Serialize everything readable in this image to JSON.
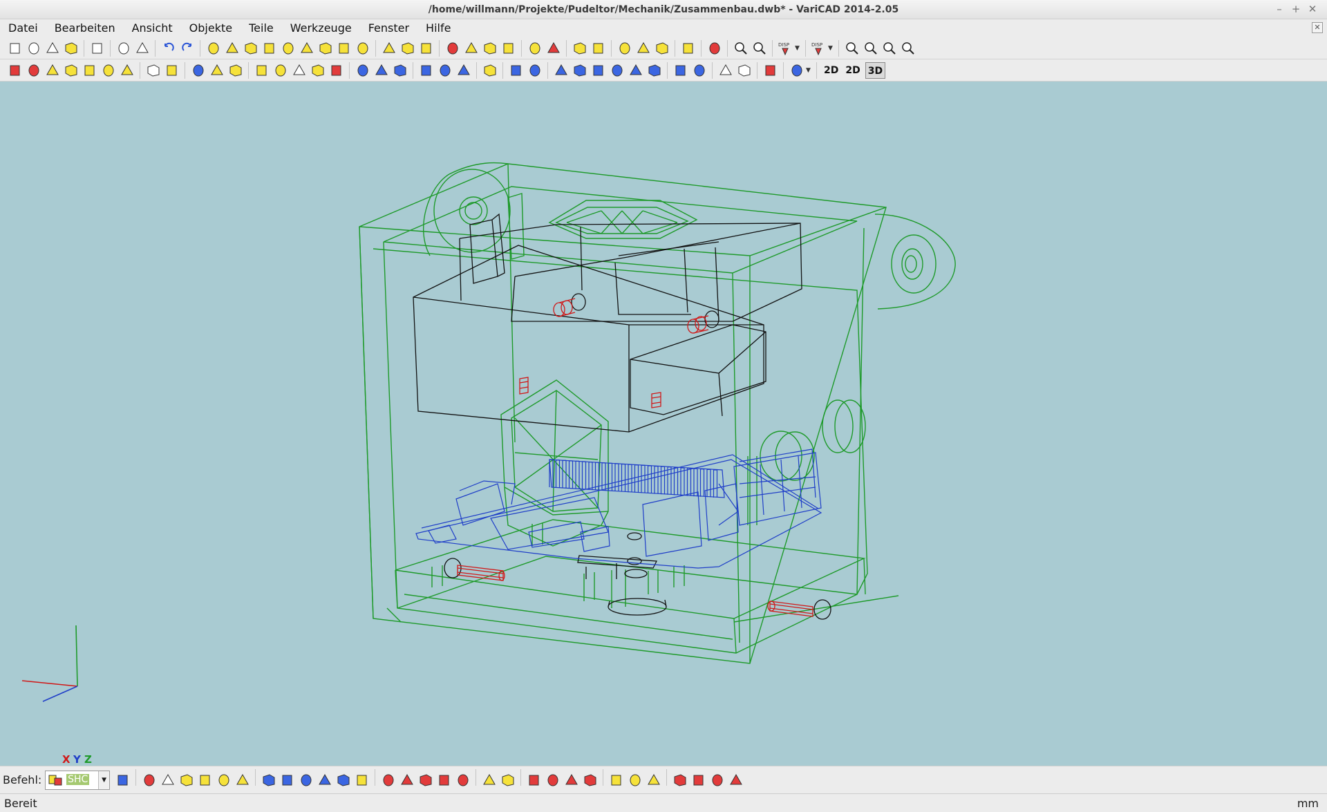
{
  "window": {
    "title": "/home/willmann/Projekte/Pudeltor/Mechanik/Zusammenbau.dwb* - VariCAD 2014-2.05",
    "controls": [
      "–",
      "+",
      "✕"
    ]
  },
  "menu": [
    "Datei",
    "Bearbeiten",
    "Ansicht",
    "Objekte",
    "Teile",
    "Werkzeuge",
    "Fenster",
    "Hilfe"
  ],
  "toolbar1": {
    "groups": [
      [
        "new-file",
        "open-file",
        "save-file",
        "save-all"
      ],
      [
        "print"
      ],
      [
        "copy",
        "paste"
      ],
      [
        "undo",
        "redo"
      ],
      [
        "box-solid",
        "cylinder-solid",
        "cone-solid",
        "paraboloid-solid",
        "torus-solid",
        "sphere-solid",
        "pipe-solid",
        "elbow-solid",
        "half-sphere-solid"
      ],
      [
        "move-object",
        "rotate-object",
        "scale-object"
      ],
      [
        "cut-solid",
        "fillet-solid",
        "chamfer-solid",
        "shell-solid"
      ],
      [
        "boolean-add",
        "boolean-cut"
      ],
      [
        "transform-xyz",
        "transform-align"
      ],
      [
        "info-object",
        "info-distance",
        "info-angle"
      ],
      [
        "measure-pencil"
      ],
      [
        "display-red-box"
      ],
      [
        "zoom-window",
        "zoom-fit"
      ],
      [
        "disp-1"
      ],
      [
        "disp-2"
      ],
      [
        "zoom-in",
        "zoom-out",
        "zoom-prev",
        "zoom-next"
      ]
    ],
    "disp_label": "DISP"
  },
  "toolbar2": {
    "groups": [
      [
        "delete-object",
        "delete-all",
        "edit-object",
        "insert-text",
        "insert-bolt",
        "insert-nut",
        "insert-pin"
      ],
      [
        "hidden-box",
        "solid-box"
      ],
      [
        "color-layers",
        "percent",
        "select-tool"
      ],
      [
        "pin-solid",
        "cylinder-yellow",
        "profile-solid",
        "box-edit",
        "box-cut"
      ],
      [
        "assembly-1",
        "assembly-2",
        "assembly-3"
      ],
      [
        "link-1",
        "link-2",
        "link-3"
      ],
      [
        "group-tool"
      ],
      [
        "query-1",
        "query-2"
      ],
      [
        "path-1",
        "path-2",
        "path-3",
        "path-4",
        "path-5",
        "path-6"
      ],
      [
        "axis-1",
        "axis-2"
      ],
      [
        "sheet-1",
        "sheet-2"
      ],
      [
        "red-tool"
      ],
      [
        "layer-manager"
      ]
    ],
    "mode_buttons": [
      "2D",
      "2D",
      "3D"
    ]
  },
  "viewport": {
    "background": "#a9cbd2",
    "axis_labels": [
      "X",
      "Y",
      "Z"
    ],
    "colors": {
      "frame": "#1e9a2a",
      "electronics": "#1f3ec8",
      "parts": "#111111",
      "fasteners": "#d01818"
    }
  },
  "command": {
    "label": "Befehl:",
    "value": "SHC",
    "buttons": [
      "cmd-repeat",
      "box-red",
      "profile-yellow",
      "angle-tool",
      "section-1",
      "section-2",
      "section-3",
      "tree-1",
      "tree-2",
      "tree-3",
      "tree-4",
      "tree-5",
      "light",
      "hier-1",
      "hier-2",
      "hier-3",
      "hier-4",
      "hier-5",
      "rotate-1",
      "rotate-2",
      "pos-1",
      "pos-2",
      "pos-3",
      "pos-4",
      "grp-1",
      "grp-2",
      "grp-3",
      "del-1",
      "del-2",
      "del-3",
      "del-4"
    ]
  },
  "status": {
    "left": "Bereit",
    "right": "mm"
  }
}
